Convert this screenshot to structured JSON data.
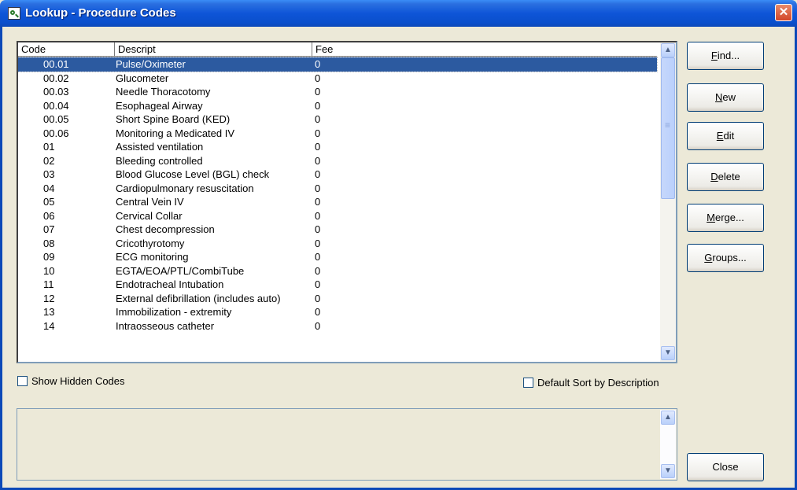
{
  "window": {
    "title": "Lookup - Procedure Codes",
    "close_glyph": "✕"
  },
  "list": {
    "columns": [
      "Code",
      "Descript",
      "Fee"
    ],
    "rows": [
      {
        "code": "00.01",
        "desc": "Pulse/Oximeter",
        "fee": "0"
      },
      {
        "code": "00.02",
        "desc": "Glucometer",
        "fee": "0"
      },
      {
        "code": "00.03",
        "desc": "Needle Thoracotomy",
        "fee": "0"
      },
      {
        "code": "00.04",
        "desc": "Esophageal Airway",
        "fee": "0"
      },
      {
        "code": "00.05",
        "desc": "Short Spine Board (KED)",
        "fee": "0"
      },
      {
        "code": "00.06",
        "desc": "Monitoring a Medicated IV",
        "fee": "0"
      },
      {
        "code": "01",
        "desc": "Assisted ventilation",
        "fee": "0"
      },
      {
        "code": "02",
        "desc": "Bleeding controlled",
        "fee": "0"
      },
      {
        "code": "03",
        "desc": "Blood Glucose Level (BGL) check",
        "fee": "0"
      },
      {
        "code": "04",
        "desc": "Cardiopulmonary resuscitation",
        "fee": "0"
      },
      {
        "code": "05",
        "desc": "Central Vein IV",
        "fee": "0"
      },
      {
        "code": "06",
        "desc": "Cervical Collar",
        "fee": "0"
      },
      {
        "code": "07",
        "desc": "Chest decompression",
        "fee": "0"
      },
      {
        "code": "08",
        "desc": "Cricothyrotomy",
        "fee": "0"
      },
      {
        "code": "09",
        "desc": "ECG monitoring",
        "fee": "0"
      },
      {
        "code": "10",
        "desc": "EGTA/EOA/PTL/CombiTube",
        "fee": "0"
      },
      {
        "code": "11",
        "desc": "Endotracheal Intubation",
        "fee": "0"
      },
      {
        "code": "12",
        "desc": "External defibrillation (includes auto)",
        "fee": "0"
      },
      {
        "code": "13",
        "desc": "Immobilization - extremity",
        "fee": "0"
      },
      {
        "code": "14",
        "desc": "Intraosseous catheter",
        "fee": "0"
      }
    ],
    "selected_index": 0
  },
  "options": {
    "show_hidden": "Show Hidden Codes",
    "default_sort": "Default Sort by Description"
  },
  "buttons": {
    "find": {
      "pre": "",
      "key": "F",
      "post": "ind..."
    },
    "new": {
      "pre": "",
      "key": "N",
      "post": "ew"
    },
    "edit": {
      "pre": "",
      "key": "E",
      "post": "dit"
    },
    "delete": {
      "pre": "",
      "key": "D",
      "post": "elete"
    },
    "merge": {
      "pre": "",
      "key": "M",
      "post": "erge..."
    },
    "groups": {
      "pre": "",
      "key": "G",
      "post": "roups..."
    },
    "close": "Close"
  },
  "icons": {
    "scroll_up": "▲",
    "scroll_down": "▼",
    "app": "magnifier-document-icon"
  },
  "colors": {
    "titlebar": "#0c55d8",
    "selection": "#2c5aa0",
    "close_button": "#d2462a"
  }
}
